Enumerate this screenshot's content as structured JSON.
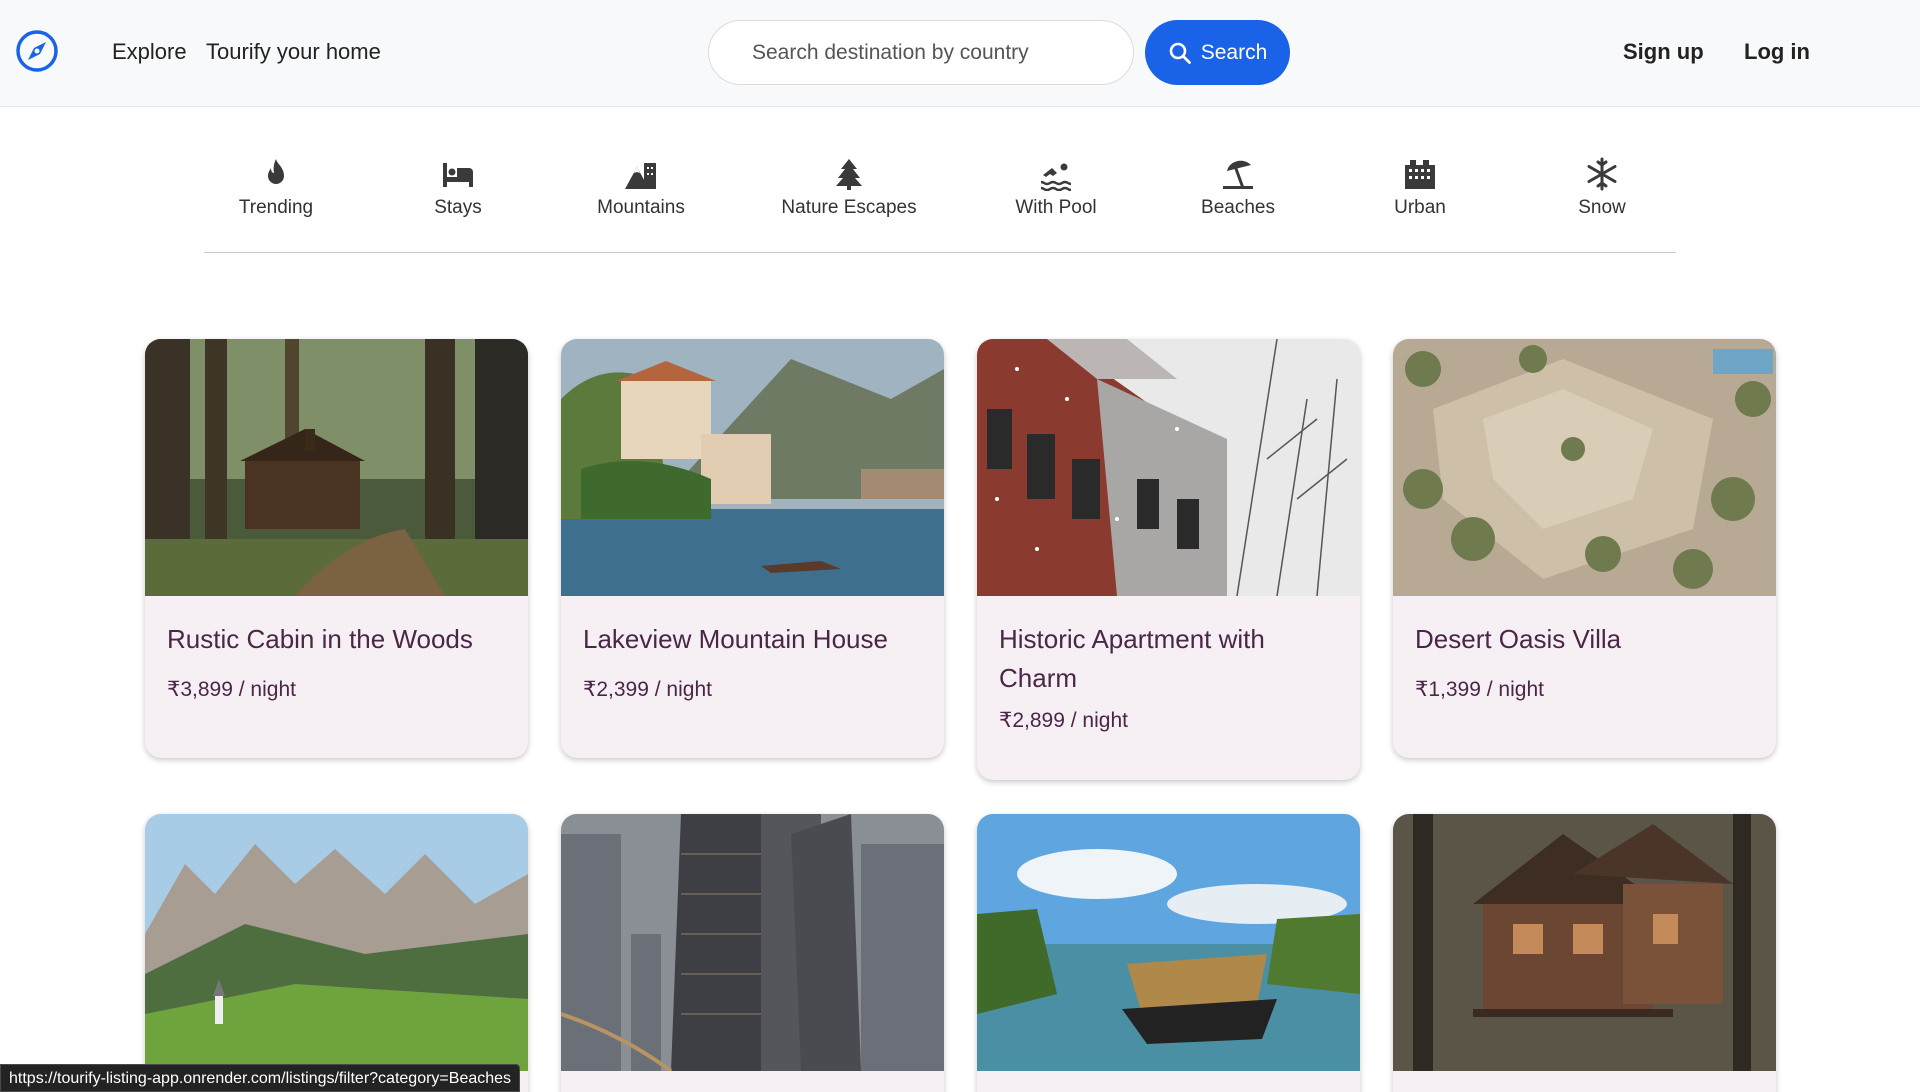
{
  "nav": {
    "links": [
      "Explore",
      "Tourify your home"
    ],
    "search_placeholder": "Search destination by country",
    "search_button": "Search",
    "signup": "Sign up",
    "login": "Log in",
    "accent_color": "#1a63e9"
  },
  "filters": [
    {
      "label": "Trending",
      "icon": "fire-icon"
    },
    {
      "label": "Stays",
      "icon": "bed-icon"
    },
    {
      "label": "Mountains",
      "icon": "mountain-city-icon"
    },
    {
      "label": "Nature Escapes",
      "icon": "tree-icon"
    },
    {
      "label": "With Pool",
      "icon": "swimmer-icon"
    },
    {
      "label": "Beaches",
      "icon": "umbrella-beach-icon"
    },
    {
      "label": "Urban",
      "icon": "city-icon"
    },
    {
      "label": "Snow",
      "icon": "snowflake-icon"
    }
  ],
  "listings": [
    {
      "title": "Rustic Cabin in the Woods",
      "price": "₹3,899 / night",
      "image": "forest-cabin"
    },
    {
      "title": "Lakeview Mountain House",
      "price": "₹2,399 / night",
      "image": "lake-villa"
    },
    {
      "title": "Historic Apartment with Charm",
      "price": "₹2,899 / night",
      "image": "snowy-brick-building"
    },
    {
      "title": "Desert Oasis Villa",
      "price": "₹1,399 / night",
      "image": "desert-palm-villa"
    },
    {
      "title": "",
      "price": "",
      "image": "alpine-meadow"
    },
    {
      "title": "",
      "price": "",
      "image": "city-skyscrapers"
    },
    {
      "title": "",
      "price": "",
      "image": "houseboat-backwaters"
    },
    {
      "title": "",
      "price": "",
      "image": "treehouse"
    }
  ],
  "status_url": "https://tourify-listing-app.onrender.com/listings/filter?category=Beaches"
}
